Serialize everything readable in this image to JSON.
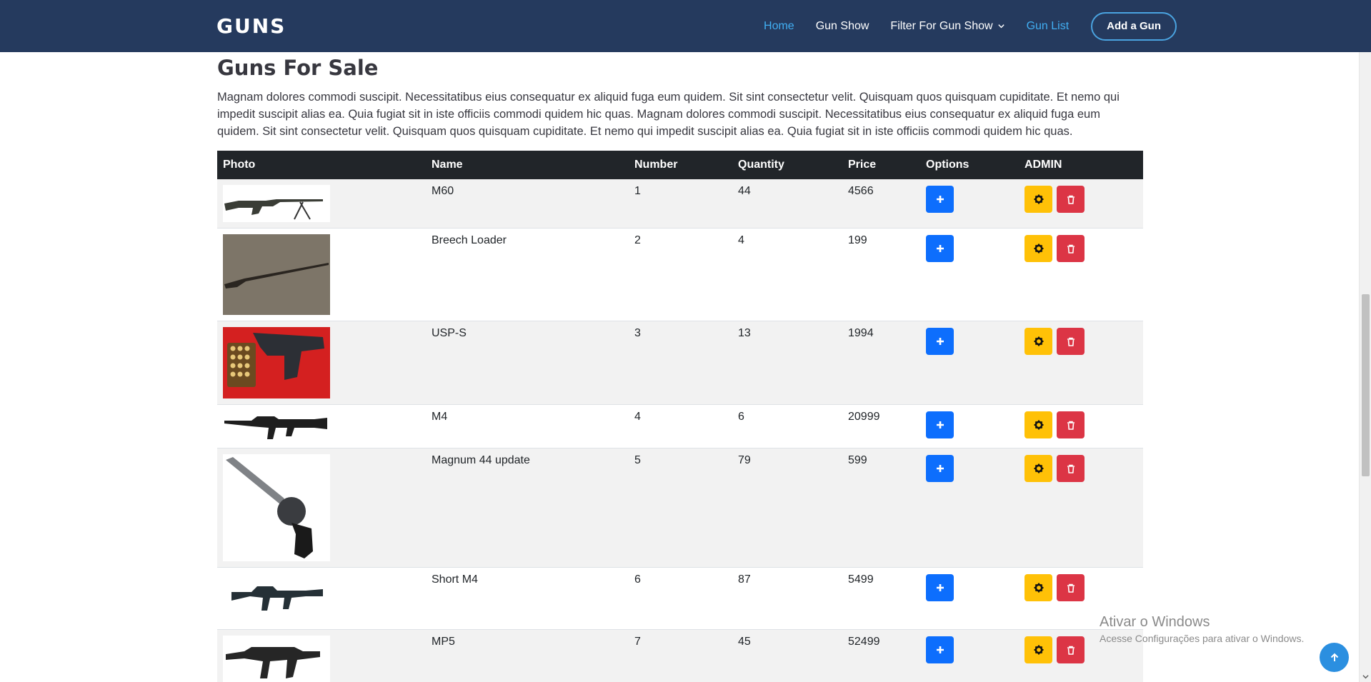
{
  "header": {
    "logo": "GUNS",
    "nav": [
      {
        "label": "Home"
      },
      {
        "label": "Gun Show"
      },
      {
        "label": "Filter For Gun Show"
      },
      {
        "label": "Gun List"
      }
    ],
    "cta_label": "Add a Gun"
  },
  "page": {
    "title": "Guns For Sale",
    "intro": "Magnam dolores commodi suscipit. Necessitatibus eius consequatur ex aliquid fuga eum quidem. Sit sint consectetur velit. Quisquam quos quisquam cupiditate. Et nemo qui impedit suscipit alias ea. Quia fugiat sit in iste officiis commodi quidem hic quas. Magnam dolores commodi suscipit. Necessitatibus eius consequatur ex aliquid fuga eum quidem. Sit sint consectetur velit. Quisquam quos quisquam cupiditate. Et nemo qui impedit suscipit alias ea. Quia fugiat sit in iste officiis commodi quidem hic quas."
  },
  "table": {
    "columns": [
      "Photo",
      "Name",
      "Number",
      "Quantity",
      "Price",
      "Options",
      "ADMIN"
    ],
    "rows": [
      {
        "name": "M60",
        "number": "1",
        "quantity": "44",
        "price": "4566"
      },
      {
        "name": "Breech Loader",
        "number": "2",
        "quantity": "4",
        "price": "199"
      },
      {
        "name": "USP-S",
        "number": "3",
        "quantity": "13",
        "price": "1994"
      },
      {
        "name": "M4",
        "number": "4",
        "quantity": "6",
        "price": "20999"
      },
      {
        "name": "Magnum 44 update",
        "number": "5",
        "quantity": "79",
        "price": "599"
      },
      {
        "name": "Short M4",
        "number": "6",
        "quantity": "87",
        "price": "5499"
      },
      {
        "name": "MP5",
        "number": "7",
        "quantity": "45",
        "price": "52499"
      }
    ]
  },
  "windows_watermark": {
    "line1": "Ativar o Windows",
    "line2": "Acesse Configurações para ativar o Windows."
  },
  "colors": {
    "header_bg": "#253a5e",
    "nav_active": "#41aef2",
    "table_head_bg": "#212529",
    "btn_add": "#0d6efd",
    "btn_edit": "#ffc107",
    "btn_delete": "#dc3545"
  },
  "icons": {
    "add": "plus-icon",
    "edit": "gear-icon",
    "delete": "trash-icon",
    "dropdown": "chevron-down-icon",
    "back_to_top": "arrow-up-icon"
  }
}
